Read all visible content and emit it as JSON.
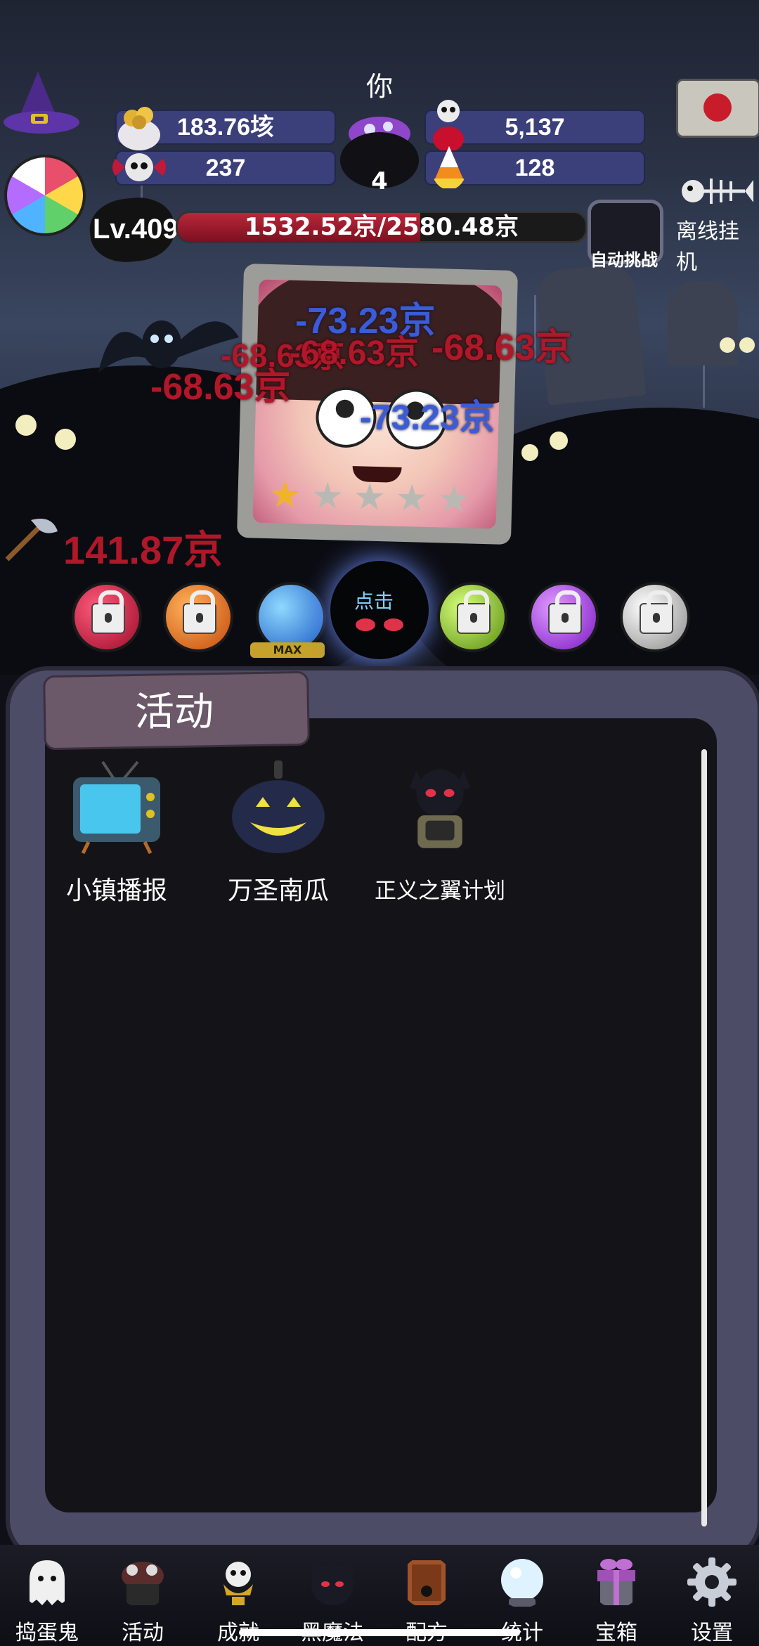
{
  "header": {
    "player_name": "你",
    "resources": {
      "coins": "183.76垓",
      "poison": "5,137",
      "candy_bones": "237",
      "candy_corn": "128"
    },
    "cauldron_count": "4",
    "level": "Lv.409",
    "hp": {
      "text": "1532.52京/2580.48京",
      "fraction": 0.594
    },
    "auto_challenge_label": "自动挑战",
    "offline_label": "离线挂机"
  },
  "battle": {
    "damage_numbers": {
      "d1": "-73.23京",
      "d2": "-68.63京",
      "d3": "-68.63京",
      "d4": "-68.63京",
      "d5": "-73.23京"
    },
    "axe_damage": "141.87京",
    "boss_stars_filled": 1,
    "boss_stars_total": 5,
    "tap_hint": "点击",
    "max_label": "MAX"
  },
  "panel": {
    "title": "活动",
    "activities": [
      {
        "label": "小镇播报",
        "icon": "tv-icon"
      },
      {
        "label": "万圣南瓜",
        "icon": "pumpkin-icon"
      },
      {
        "label": "正义之翼计划",
        "icon": "devil-trophy-icon"
      }
    ]
  },
  "nav": {
    "items": [
      {
        "label": "捣蛋鬼",
        "icon": "ghost-icon"
      },
      {
        "label": "活动",
        "icon": "cupcake-icon"
      },
      {
        "label": "成就",
        "icon": "skull-trophy-icon"
      },
      {
        "label": "黑魔法",
        "icon": "devil-icon"
      },
      {
        "label": "配方",
        "icon": "spellbook-icon"
      },
      {
        "label": "统计",
        "icon": "crystal-ball-icon"
      },
      {
        "label": "宝箱",
        "icon": "gift-box-icon"
      },
      {
        "label": "设置",
        "icon": "gear-icon"
      }
    ]
  },
  "colors": {
    "hp_fill": "#b8283a",
    "damage_red": "#b0182a",
    "damage_blue": "#3b5bd9",
    "resource_bar": "#3b3f7a",
    "panel_frame": "#4d4c66"
  }
}
